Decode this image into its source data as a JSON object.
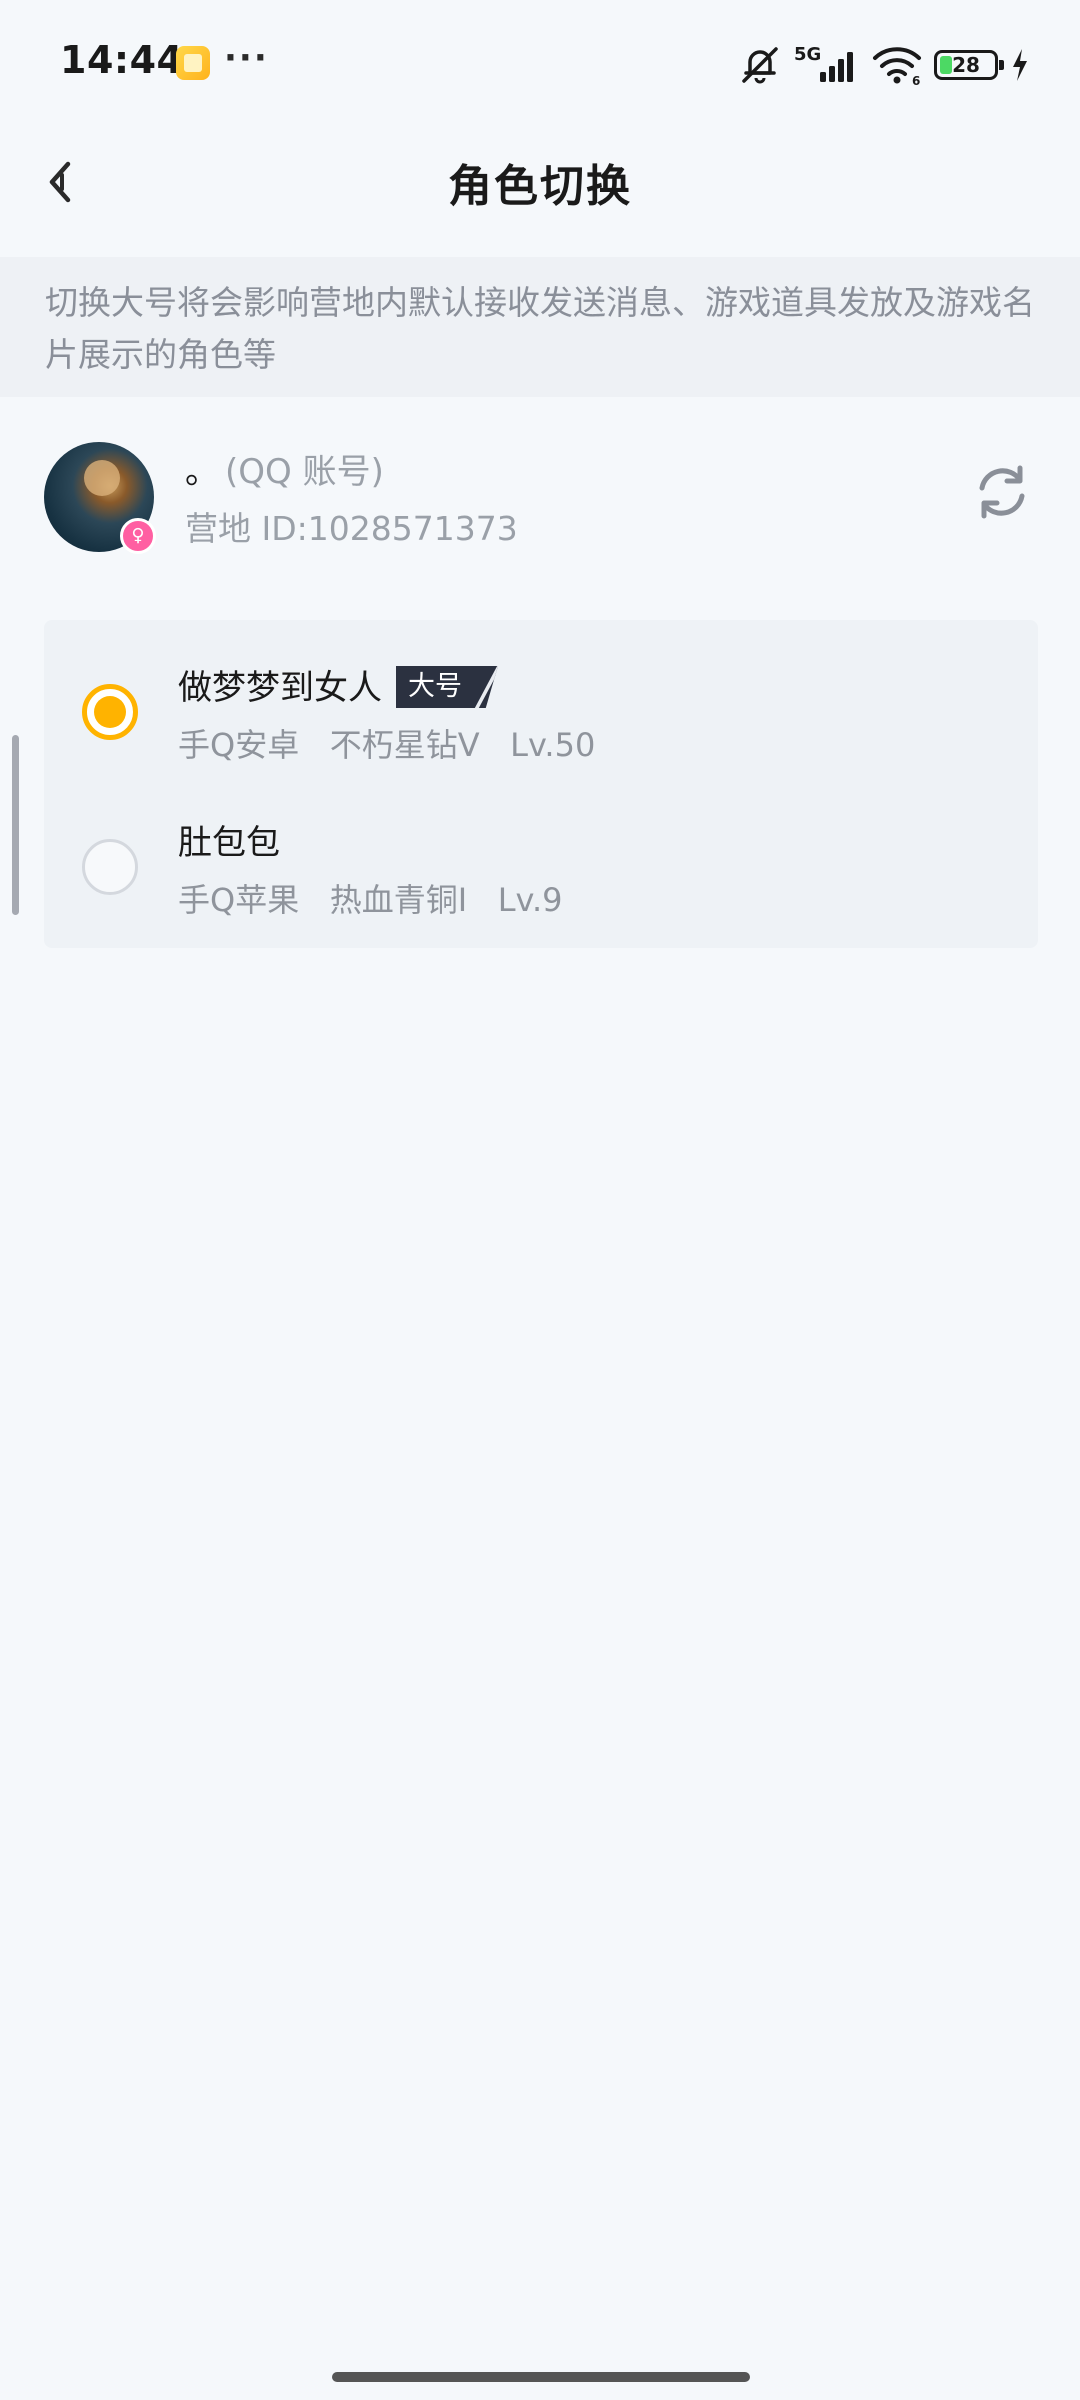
{
  "status_bar": {
    "time": "14:44",
    "more": "···",
    "network": "5G",
    "battery_percent": "28",
    "icons": [
      "app-notification-icon",
      "mute-icon",
      "signal-icon",
      "wifi-icon",
      "battery-icon",
      "charging-icon"
    ]
  },
  "header": {
    "title": "角色切换",
    "back_icon": "back-arrow-icon"
  },
  "notice": {
    "text": "切换大号将会影响营地内默认接收发送消息、游戏道具发放及游戏名片展示的角色等"
  },
  "account": {
    "name": "。",
    "type_tag": "(QQ 账号)",
    "camp_id": "营地 ID:1028571373",
    "gender_icon": "female-icon",
    "refresh_icon": "refresh-icon"
  },
  "roles": [
    {
      "name": "做梦梦到女人",
      "badge": "大号",
      "platform": "手Q安卓",
      "rank": "不朽星钻V",
      "level": "Lv.50",
      "selected": true
    },
    {
      "name": "肚包包",
      "badge": "",
      "platform": "手Q苹果",
      "rank": "热血青铜I",
      "level": "Lv.9",
      "selected": false
    }
  ],
  "colors": {
    "accent": "#ffb300",
    "background": "#f5f8fb",
    "notice_bg": "#eef1f5",
    "badge_bg": "#2b3140",
    "gender_badge": "#ff5fa2"
  }
}
